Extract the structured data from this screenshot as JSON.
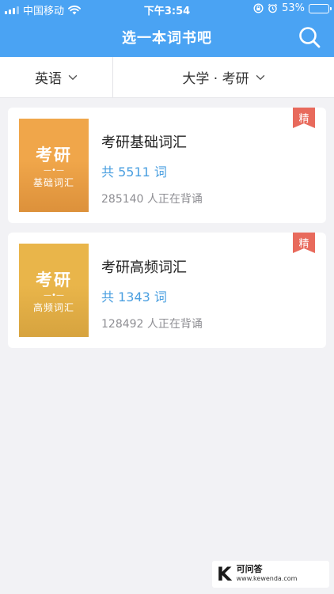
{
  "status_bar": {
    "carrier": "中国移动",
    "time": "下午3:54",
    "battery": "53%",
    "battery_level": 0.53,
    "icons": [
      "signal-icon",
      "wifi-icon",
      "orientation-lock-icon",
      "alarm-icon",
      "battery-icon"
    ]
  },
  "nav": {
    "title": "选一本词书吧",
    "search_icon": "search-icon"
  },
  "filters": {
    "language": "英语",
    "level": "大学 · 考研"
  },
  "books": [
    {
      "cover_title": "考研",
      "cover_subtitle": "基础词汇",
      "name": "考研基础词汇",
      "count": "共 5511 词",
      "learners": "285140 人正在背诵",
      "badge": "精",
      "cover_color": "#f0a64a"
    },
    {
      "cover_title": "考研",
      "cover_subtitle": "高频词汇",
      "name": "考研高频词汇",
      "count": "共 1343 词",
      "learners": "128492 人正在背诵",
      "badge": "精",
      "cover_color": "#e9b54a"
    }
  ],
  "colors": {
    "header": "#4aa3f3",
    "accent": "#4a9fe0",
    "badge": "#e86a5c",
    "background": "#f2f2f5"
  },
  "watermark": {
    "logo": "K",
    "name": "可问答",
    "url": "www.kewenda.com"
  }
}
